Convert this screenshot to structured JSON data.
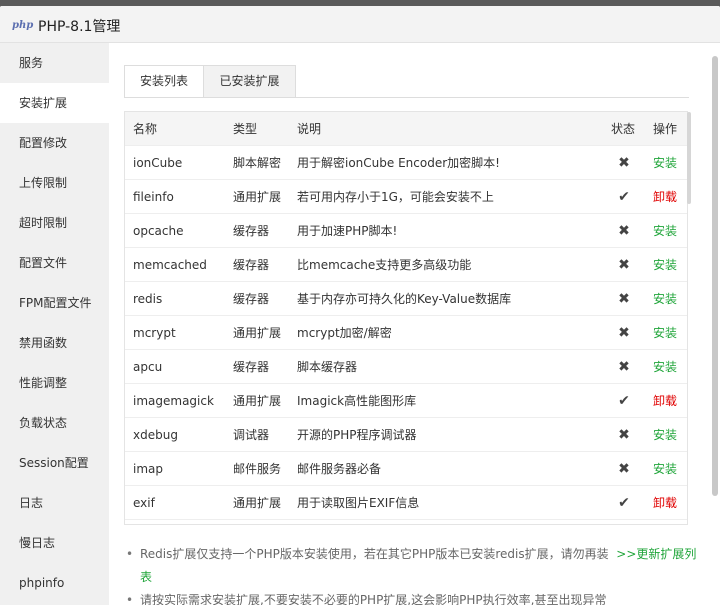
{
  "window": {
    "logo": "php",
    "title": "PHP-8.1管理"
  },
  "sidebar": {
    "items": [
      {
        "label": "服务"
      },
      {
        "label": "安装扩展"
      },
      {
        "label": "配置修改"
      },
      {
        "label": "上传限制"
      },
      {
        "label": "超时限制"
      },
      {
        "label": "配置文件"
      },
      {
        "label": "FPM配置文件"
      },
      {
        "label": "禁用函数"
      },
      {
        "label": "性能调整"
      },
      {
        "label": "负载状态"
      },
      {
        "label": "Session配置"
      },
      {
        "label": "日志"
      },
      {
        "label": "慢日志"
      },
      {
        "label": "phpinfo"
      }
    ],
    "active_index": 1
  },
  "tabs": [
    {
      "label": "安装列表"
    },
    {
      "label": "已安装扩展"
    }
  ],
  "table": {
    "headers": {
      "name": "名称",
      "type": "类型",
      "desc": "说明",
      "status": "状态",
      "op": "操作"
    },
    "rows": [
      {
        "name": "ionCube",
        "type": "脚本解密",
        "desc": "用于解密ionCube Encoder加密脚本!",
        "installed": false,
        "op": "安装"
      },
      {
        "name": "fileinfo",
        "type": "通用扩展",
        "desc": "若可用内存小于1G，可能会安装不上",
        "installed": true,
        "op": "卸载"
      },
      {
        "name": "opcache",
        "type": "缓存器",
        "desc": "用于加速PHP脚本!",
        "installed": false,
        "op": "安装"
      },
      {
        "name": "memcached",
        "type": "缓存器",
        "desc": "比memcache支持更多高级功能",
        "installed": false,
        "op": "安装"
      },
      {
        "name": "redis",
        "type": "缓存器",
        "desc": "基于内存亦可持久化的Key-Value数据库",
        "installed": false,
        "op": "安装"
      },
      {
        "name": "mcrypt",
        "type": "通用扩展",
        "desc": "mcrypt加密/解密",
        "installed": false,
        "op": "安装"
      },
      {
        "name": "apcu",
        "type": "缓存器",
        "desc": "脚本缓存器",
        "installed": false,
        "op": "安装"
      },
      {
        "name": "imagemagick",
        "type": "通用扩展",
        "desc": "Imagick高性能图形库",
        "installed": true,
        "op": "卸载"
      },
      {
        "name": "xdebug",
        "type": "调试器",
        "desc": "开源的PHP程序调试器",
        "installed": false,
        "op": "安装"
      },
      {
        "name": "imap",
        "type": "邮件服务",
        "desc": "邮件服务器必备",
        "installed": false,
        "op": "安装"
      },
      {
        "name": "exif",
        "type": "通用扩展",
        "desc": "用于读取图片EXIF信息",
        "installed": true,
        "op": "卸载"
      }
    ]
  },
  "icons": {
    "installed": "check-icon",
    "not_installed": "cross-icon"
  },
  "colors": {
    "install": "#20a53a",
    "uninstall": "#e00000"
  },
  "notes": {
    "note1": "Redis扩展仅支持一个PHP版本安装使用，若在其它PHP版本已安装redis扩展，请勿再装",
    "note1_link": ">>更新扩展列表",
    "note2": "请按实际需求安装扩展,不要安装不必要的PHP扩展,这会影响PHP执行效率,甚至出现异常"
  }
}
